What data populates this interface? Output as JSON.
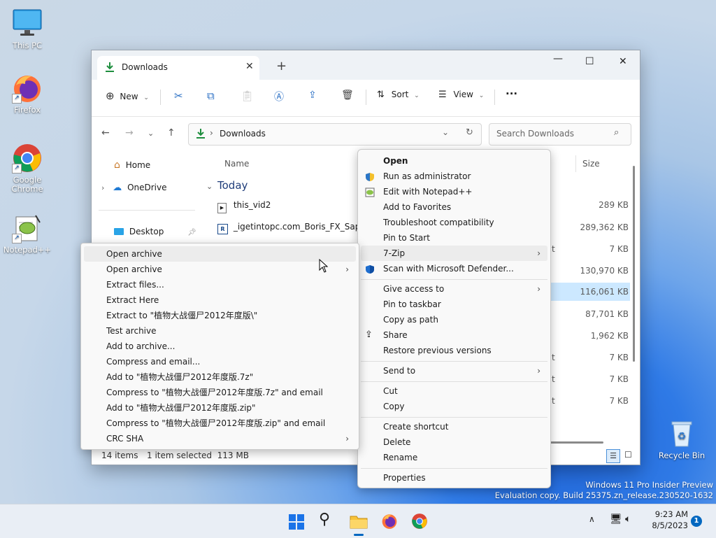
{
  "desktop": {
    "icons": [
      {
        "label": "This PC",
        "icon": "monitor-icon"
      },
      {
        "label": "Firefox",
        "icon": "firefox-icon"
      },
      {
        "label": "Google Chrome",
        "icon": "chrome-icon"
      },
      {
        "label": "Notepad++",
        "icon": "notepadpp-icon"
      },
      {
        "label": "Recycle Bin",
        "icon": "recycle-bin-icon"
      }
    ],
    "watermark_line1": "Windows 11 Pro Insider Preview",
    "watermark_line2": "Evaluation copy. Build 25375.zn_release.230520-1632"
  },
  "explorer": {
    "tab_title": "Downloads",
    "toolbar": {
      "new_label": "New",
      "sort_label": "Sort",
      "view_label": "View",
      "more_label": "···"
    },
    "address": {
      "path": "Downloads",
      "search_placeholder": "Search Downloads"
    },
    "sidebar": [
      {
        "label": "Home"
      },
      {
        "label": "OneDrive"
      },
      {
        "label": "Desktop"
      }
    ],
    "columns": {
      "name": "Name",
      "size": "Size"
    },
    "group_label": "Today",
    "files": [
      {
        "name": "this_vid2",
        "size": "289 KB"
      },
      {
        "name": "_igetintopc.com_Boris_FX_Sapphire",
        "size": "289,362 KB"
      }
    ],
    "sizes": [
      "7 KB",
      "130,970 KB",
      "116,061 KB",
      "87,701 KB",
      "1,962 KB",
      "7 KB",
      "7 KB",
      "7 KB"
    ],
    "partial_letters": [
      "t",
      "t",
      "t",
      "t"
    ],
    "status": {
      "count": "14 items",
      "selection": "1 item selected  113 MB"
    }
  },
  "context_menu": {
    "items": [
      {
        "label": "Open",
        "bold": true
      },
      {
        "label": "Run as administrator",
        "icon": "shield-icon"
      },
      {
        "label": "Edit with Notepad++",
        "icon": "notepadpp-icon"
      },
      {
        "label": "Add to Favorites"
      },
      {
        "label": "Troubleshoot compatibility"
      },
      {
        "label": "Pin to Start"
      },
      {
        "label": "7-Zip",
        "submenu": true,
        "highlighted": true
      },
      {
        "label": "Scan with Microsoft Defender...",
        "icon": "defender-icon"
      },
      {
        "label": "Give access to",
        "submenu": true
      },
      {
        "label": "Pin to taskbar"
      },
      {
        "label": "Copy as path"
      },
      {
        "label": "Share",
        "icon": "share-icon"
      },
      {
        "label": "Restore previous versions"
      },
      {
        "label": "Send to",
        "submenu": true
      },
      {
        "label": "Cut"
      },
      {
        "label": "Copy"
      },
      {
        "label": "Create shortcut"
      },
      {
        "label": "Delete"
      },
      {
        "label": "Rename"
      },
      {
        "label": "Properties"
      }
    ],
    "submenu_arrow": "›"
  },
  "zip_menu": {
    "items": [
      {
        "label": "Open archive",
        "highlighted": true
      },
      {
        "label": "Open archive",
        "submenu": true
      },
      {
        "label": "Extract files..."
      },
      {
        "label": "Extract Here"
      },
      {
        "label": "Extract to \"植物大战僵尸2012年度版\\\""
      },
      {
        "label": "Test archive"
      },
      {
        "label": "Add to archive..."
      },
      {
        "label": "Compress and email..."
      },
      {
        "label": "Add to \"植物大战僵尸2012年度版.7z\""
      },
      {
        "label": "Compress to \"植物大战僵尸2012年度版.7z\" and email"
      },
      {
        "label": "Add to \"植物大战僵尸2012年度版.zip\""
      },
      {
        "label": "Compress to \"植物大战僵尸2012年度版.zip\" and email"
      },
      {
        "label": "CRC SHA",
        "submenu": true
      }
    ]
  },
  "taskbar": {
    "time": "9:23 AM",
    "date": "8/5/2023",
    "notification_count": "1"
  },
  "colors": {
    "accent": "#0067c0",
    "selection": "#cce8ff",
    "green_download": "#1e8e3e"
  }
}
